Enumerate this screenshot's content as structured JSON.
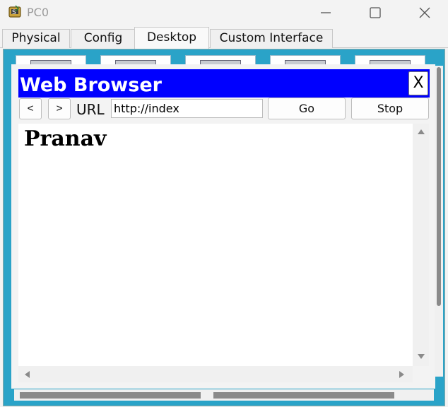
{
  "window": {
    "title": "PC0",
    "icon": "packet-tracer-pc-icon"
  },
  "tabs": [
    {
      "label": "Physical"
    },
    {
      "label": "Config"
    },
    {
      "label": "Desktop",
      "active": true
    },
    {
      "label": "Custom Interface"
    }
  ],
  "browser": {
    "title": "Web Browser",
    "close_label": "X",
    "back_label": "<",
    "forward_label": ">",
    "url_label": "URL",
    "url_value": "http://index",
    "go_label": "Go",
    "stop_label": "Stop",
    "page_heading": "Pranav"
  },
  "colors": {
    "browser_title_bg": "#0000ff",
    "desktop_bg": "#2aa3c8"
  }
}
